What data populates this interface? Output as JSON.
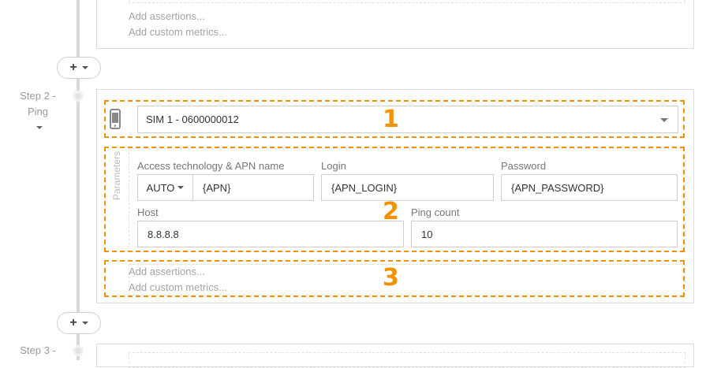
{
  "step1": {
    "add_assertions": "Add assertions...",
    "add_custom_metrics": "Add custom metrics..."
  },
  "add_step_button": {
    "icon": "plus-icon"
  },
  "step2": {
    "label_line1": "Step 2 -",
    "label_line2": "Ping",
    "sim_select": {
      "value": "SIM 1 - 0600000012",
      "icon": "mobile-phone-icon"
    },
    "parameters_label": "Parameters",
    "fields": {
      "access_technology_label": "Access technology & APN name",
      "access_technology_value": "AUTO",
      "apn_value": "{APN}",
      "login_label": "Login",
      "login_value": "{APN_LOGIN}",
      "password_label": "Password",
      "password_value": "{APN_PASSWORD}",
      "host_label": "Host",
      "host_value": "8.8.8.8",
      "ping_count_label": "Ping count",
      "ping_count_value": "10"
    },
    "add_assertions": "Add assertions...",
    "add_custom_metrics": "Add custom metrics..."
  },
  "step3": {
    "label_line1": "Step 3 -"
  },
  "annotations": {
    "one": "1",
    "two": "2",
    "three": "3"
  },
  "colors": {
    "highlight": "#f39200",
    "border": "#dcdcdc",
    "timeline": "#d9d9d9"
  }
}
